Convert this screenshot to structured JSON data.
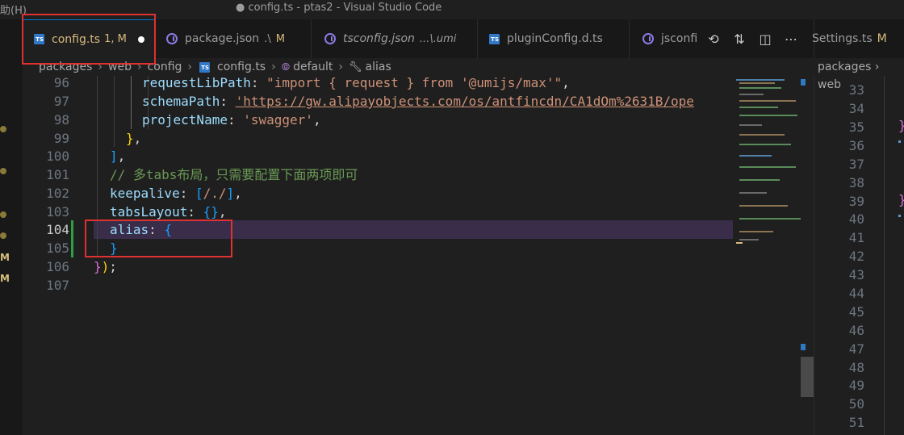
{
  "titlebar": {
    "menu": "助(H)",
    "title": "● config.ts - ptas2 - Visual Studio Code"
  },
  "tabs": [
    {
      "label": "config.ts",
      "problems": "1, M",
      "dirty": true,
      "active": true,
      "icon": "ts-icon"
    },
    {
      "label": "package.json",
      "desc": ".\\",
      "mod": "M",
      "icon": "json-icon"
    },
    {
      "label": "tsconfig.json",
      "desc": "...\\.umi",
      "icon": "json-icon"
    },
    {
      "label": "pluginConfig.d.ts",
      "icon": "ts-icon"
    },
    {
      "label": "jsconfi",
      "icon": "json-icon"
    }
  ],
  "tab_actions": [
    "history-icon",
    "compare-icon",
    "split-editor-icon",
    "more-icon"
  ],
  "breadcrumb": {
    "items": [
      "packages",
      "web",
      "config"
    ],
    "file": "config.ts",
    "symbols": [
      "default",
      "alias"
    ]
  },
  "line_numbers": [
    "96",
    "97",
    "98",
    "99",
    "100",
    "101",
    "102",
    "103",
    "104",
    "105",
    "106",
    "107"
  ],
  "current_line": "104",
  "code": {
    "l96_key": "requestLibPath",
    "l96_value": "\"import { request } from '@umijs/max'\"",
    "l97_key": "schemaPath",
    "l97_value": "'https://gw.alipayobjects.com/os/antfincdn/CA1dOm%2631B/ope",
    "l98_key": "projectName",
    "l98_value": "'swagger'",
    "l101_comment": "// 多tabs布局，只需要配置下面两项即可",
    "l102_key": "keepalive",
    "l102_value": "/./",
    "l103_key": "tabsLayout",
    "l104_key": "alias"
  },
  "split": {
    "tab_label": "Settings.ts",
    "tab_mod": "M",
    "breadcrumb": "packages › web",
    "line_numbers": [
      "33",
      "34",
      "35",
      "36",
      "37",
      "38",
      "39",
      "40",
      "41",
      "42",
      "43",
      "44",
      "45",
      "46",
      "47",
      "48",
      "49",
      "50",
      "51"
    ]
  },
  "activity_markers": [
    "M",
    "M"
  ],
  "colors": {
    "accent": "#0078d4",
    "highlight": "#e03131",
    "modified": "#d7ba7d"
  }
}
